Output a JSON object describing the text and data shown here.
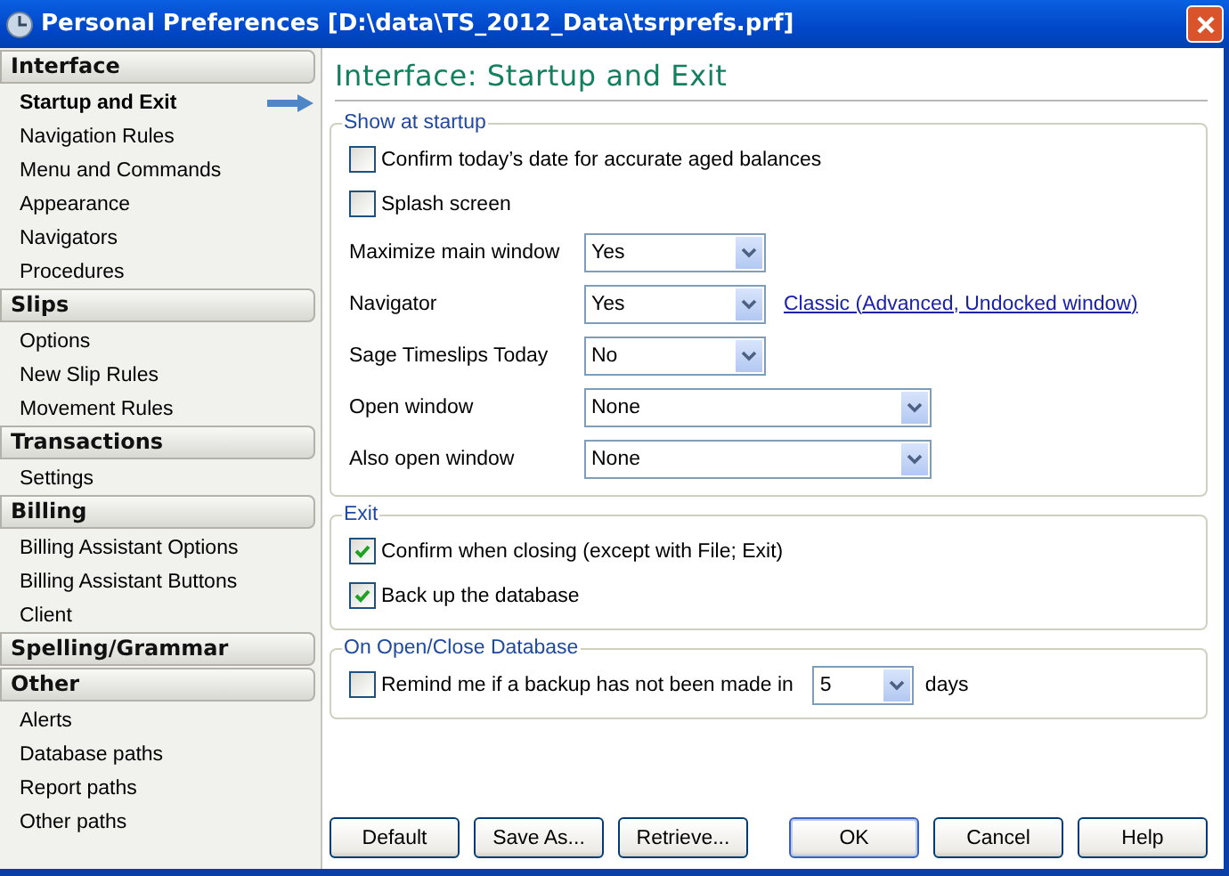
{
  "window": {
    "title": "Personal Preferences [D:\\data\\TS_2012_Data\\tsrprefs.prf]"
  },
  "sidebar": {
    "sections": [
      {
        "title": "Interface",
        "items": [
          {
            "label": "Startup and Exit",
            "selected": true
          },
          {
            "label": "Navigation Rules",
            "selected": false
          },
          {
            "label": "Menu and Commands",
            "selected": false
          },
          {
            "label": "Appearance",
            "selected": false
          },
          {
            "label": "Navigators",
            "selected": false
          },
          {
            "label": "Procedures",
            "selected": false
          }
        ]
      },
      {
        "title": "Slips",
        "items": [
          {
            "label": "Options",
            "selected": false
          },
          {
            "label": "New Slip Rules",
            "selected": false
          },
          {
            "label": "Movement Rules",
            "selected": false
          }
        ]
      },
      {
        "title": "Transactions",
        "items": [
          {
            "label": "Settings",
            "selected": false
          }
        ]
      },
      {
        "title": "Billing",
        "items": [
          {
            "label": "Billing Assistant Options",
            "selected": false
          },
          {
            "label": "Billing Assistant Buttons",
            "selected": false
          },
          {
            "label": "Client",
            "selected": false
          }
        ]
      },
      {
        "title": "Spelling/Grammar"
      },
      {
        "title": "Other",
        "items": [
          {
            "label": "Alerts",
            "selected": false
          },
          {
            "label": "Database paths",
            "selected": false
          },
          {
            "label": "Report paths",
            "selected": false
          },
          {
            "label": "Other paths",
            "selected": false
          }
        ]
      }
    ]
  },
  "page": {
    "heading": "Interface: Startup and Exit",
    "groups": [
      {
        "title": "Show at startup",
        "rows": [
          {
            "kind": "checkbox",
            "label": "Confirm today’s date for accurate aged balances",
            "checked": false
          },
          {
            "kind": "checkbox",
            "label": "Splash screen",
            "checked": false
          },
          {
            "kind": "dropdown",
            "label": "Maximize main window",
            "value": "Yes"
          },
          {
            "kind": "dropdown",
            "label": "Navigator",
            "value": "Yes",
            "link": "Classic (Advanced, Undocked window)"
          },
          {
            "kind": "dropdown",
            "label": "Sage Timeslips Today",
            "value": "No"
          },
          {
            "kind": "wide-dropdown",
            "label": "Open window",
            "value": "None"
          },
          {
            "kind": "wide-dropdown",
            "label": "Also open window",
            "value": "None"
          }
        ]
      },
      {
        "title": "Exit",
        "rows": [
          {
            "kind": "checkbox",
            "label": "Confirm when closing (except with File; Exit)",
            "checked": true
          },
          {
            "kind": "checkbox",
            "label": "Back up the database",
            "checked": true
          }
        ]
      },
      {
        "title": "On Open/Close Database",
        "rows": [
          {
            "kind": "checkbox-dropdown",
            "label": "Remind me if a backup has not been made in",
            "checked": false,
            "value": "5",
            "suffix": "days"
          }
        ]
      }
    ]
  },
  "buttons_left": [
    {
      "label": "Default",
      "default": false
    },
    {
      "label": "Save As...",
      "default": false
    },
    {
      "label": "Retrieve...",
      "default": false
    }
  ],
  "buttons_right": [
    {
      "label": "OK",
      "default": true
    },
    {
      "label": "Cancel",
      "default": false
    },
    {
      "label": "Help",
      "default": false
    }
  ]
}
